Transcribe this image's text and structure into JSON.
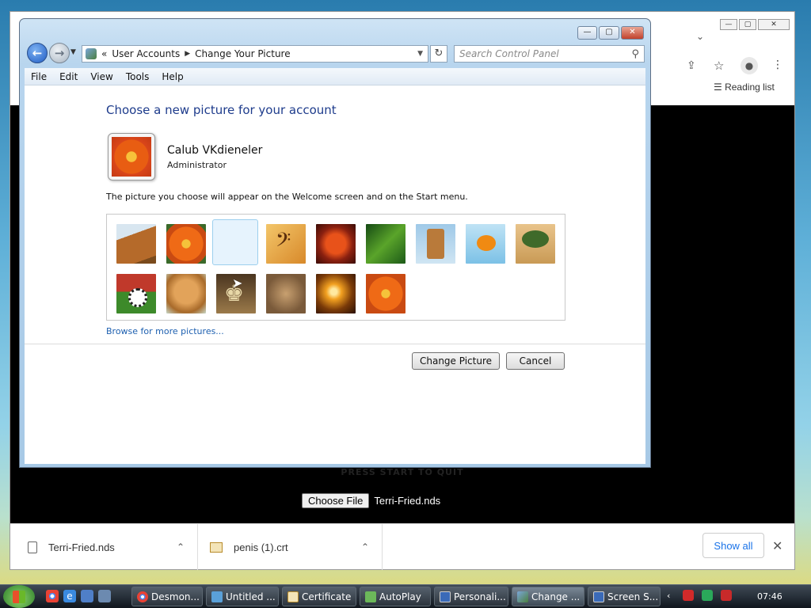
{
  "background_browser": {
    "reading_list_label": "Reading list",
    "press_start_text": "PRESS START TO QUIT",
    "choose_file_label": "Choose File",
    "chosen_file_name": "Terri-Fried.nds",
    "downloads": [
      {
        "name": "Terri-Fried.nds"
      },
      {
        "name": "penis (1).crt"
      }
    ],
    "show_all_label": "Show all"
  },
  "window": {
    "breadcrumb_prefix": "«",
    "breadcrumb": [
      "User Accounts",
      "Change Your Picture"
    ],
    "search_placeholder": "Search Control Panel",
    "menu": [
      "File",
      "Edit",
      "View",
      "Tools",
      "Help"
    ]
  },
  "page": {
    "heading": "Choose a new picture for your account",
    "user_name": "Calub VKdieneler",
    "user_role": "Administrator",
    "description": "The picture you choose will appear on the Welcome screen and on the Start menu.",
    "browse_link": "Browse for more pictures...",
    "change_button": "Change Picture",
    "cancel_button": "Cancel",
    "pictures": [
      {
        "name": "luggage",
        "row": 0,
        "selected": false
      },
      {
        "name": "orange-flower",
        "row": 0,
        "selected": false
      },
      {
        "name": "blank",
        "row": 0,
        "selected": true
      },
      {
        "name": "bass-clef",
        "row": 0,
        "selected": false
      },
      {
        "name": "starfish",
        "row": 0,
        "selected": false
      },
      {
        "name": "leaf",
        "row": 0,
        "selected": false
      },
      {
        "name": "robot",
        "row": 0,
        "selected": false
      },
      {
        "name": "goldfish",
        "row": 0,
        "selected": false
      },
      {
        "name": "bonsai",
        "row": 0,
        "selected": false
      },
      {
        "name": "soccer-ball",
        "row": 1,
        "selected": false
      },
      {
        "name": "dog",
        "row": 1,
        "selected": false
      },
      {
        "name": "chess",
        "row": 1,
        "selected": false
      },
      {
        "name": "kitten",
        "row": 1,
        "selected": false
      },
      {
        "name": "sparkles",
        "row": 1,
        "selected": false
      },
      {
        "name": "orange-flower-2",
        "row": 1,
        "selected": false
      }
    ]
  },
  "taskbar": {
    "tasks": [
      {
        "label": "Desmon...",
        "icon": "chrome-icon",
        "active": false
      },
      {
        "label": "Untitled ...",
        "icon": "paint-icon",
        "active": false
      },
      {
        "label": "Certificate",
        "icon": "certificate-icon",
        "active": false
      },
      {
        "label": "AutoPlay",
        "icon": "autoplay-icon",
        "active": false
      },
      {
        "label": "Personali...",
        "icon": "display-icon",
        "active": false
      },
      {
        "label": "Change ...",
        "icon": "users-icon",
        "active": true
      },
      {
        "label": "Screen S...",
        "icon": "display-icon",
        "active": false
      }
    ],
    "clock": "07:46"
  }
}
